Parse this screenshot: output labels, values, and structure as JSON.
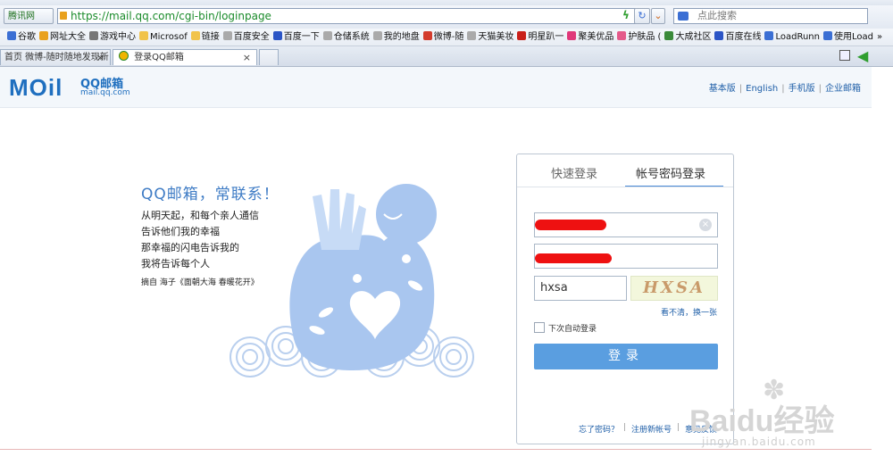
{
  "browser": {
    "brand_label": "腾讯网",
    "url": "https://mail.qq.com/cgi-bin/loginpage",
    "search_placeholder": "点此搜索",
    "favorites": [
      {
        "label": "谷歌",
        "color": "#3b6fd4"
      },
      {
        "label": "网址大全",
        "color": "#e9a11d"
      },
      {
        "label": "游戏中心",
        "color": "#777777"
      },
      {
        "label": "Microsof",
        "color": "#f1c34a"
      },
      {
        "label": "链接",
        "color": "#f1c34a"
      },
      {
        "label": "百度安全",
        "color": "#aaaaaa"
      },
      {
        "label": "百度一下",
        "color": "#2b55c6"
      },
      {
        "label": "仓储系统",
        "color": "#aaaaaa"
      },
      {
        "label": "我的地盘",
        "color": "#aaaaaa"
      },
      {
        "label": "微博-随",
        "color": "#d33b2c"
      },
      {
        "label": "天猫美妆",
        "color": "#aaaaaa"
      },
      {
        "label": "明星趴一",
        "color": "#c9201a"
      },
      {
        "label": "聚美优品",
        "color": "#e0387a"
      },
      {
        "label": "护肤品 (",
        "color": "#e45a8a"
      },
      {
        "label": "大成社区",
        "color": "#3a8a3a"
      },
      {
        "label": "百度在线",
        "color": "#2b55c6"
      },
      {
        "label": "LoadRunn",
        "color": "#3b6fd4"
      },
      {
        "label": "使用Load",
        "color": "#3b6fd4"
      }
    ],
    "favorites_more": "»",
    "tabs": [
      {
        "label": "首页 微博-随时随地发现新",
        "close": "×"
      },
      {
        "label": "登录QQ邮箱",
        "close": "×"
      }
    ]
  },
  "header": {
    "logo_text": "MOil",
    "logo_title": "QQ邮箱",
    "logo_domain": "mail.qq.com",
    "links": [
      "基本版",
      "English",
      "手机版",
      "企业邮箱"
    ]
  },
  "promo": {
    "slogan": "QQ邮箱，常联系！",
    "poem": [
      "从明天起，和每个亲人通信",
      "告诉他们我的幸福",
      "那幸福的闪电告诉我的",
      "我将告诉每个人"
    ],
    "citation": "摘自 海子《面朝大海 春暖花开》"
  },
  "login": {
    "tab_quick": "快速登录",
    "tab_password": "帐号密码登录",
    "captcha_value": "hxsa",
    "captcha_image_text": "HXSA",
    "refresh_captcha": "看不清，换一张",
    "remember_label": "下次自动登录",
    "submit_label": "登录",
    "forgot_password": "忘了密码？",
    "register": "注册新帐号",
    "feedback": "意见反馈"
  },
  "watermark": {
    "brand": "Baidu经验",
    "url": "jingyan.baidu.com"
  }
}
